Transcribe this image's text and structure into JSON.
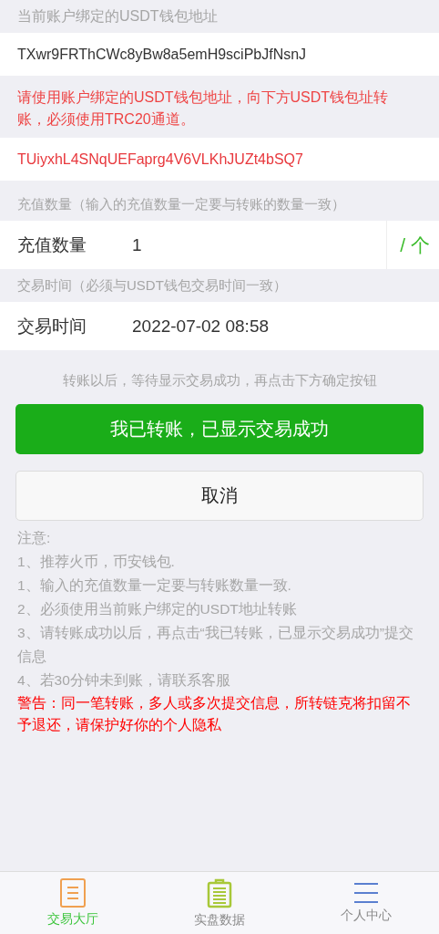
{
  "bound_wallet": {
    "label": "当前账户绑定的USDT钱包地址",
    "address": "TXwr9FRThCWc8yBw8a5emH9sciPbJfNsnJ"
  },
  "deposit_wallet": {
    "instruction": "请使用账户绑定的USDT钱包地址，向下方USDT钱包址转账，必须使用TRC20通道。",
    "address": "TUiyxhL4SNqUEFaprg4V6VLKhJUZt4bSQ7"
  },
  "amount": {
    "hint": "充值数量（输入的充值数量一定要与转账的数量一致）",
    "label": "充值数量",
    "value": "1",
    "unit": "/ 个"
  },
  "time": {
    "hint": "交易时间（必须与USDT钱包交易时间一致）",
    "label": "交易时间",
    "value": "2022-07-02 08:58"
  },
  "confirm_hint": "转账以后，等待显示交易成功，再点击下方确定按钮",
  "buttons": {
    "confirm": "我已转账，已显示交易成功",
    "cancel": "取消"
  },
  "notes": {
    "title": "注意:",
    "items": [
      "1、推荐火币，币安钱包.",
      "1、输入的充值数量一定要与转账数量一致.",
      "2、必须使用当前账户绑定的USDT地址转账",
      "3、请转账成功以后，再点击“我已转账，已显示交易成功”提交信息",
      "4、若30分钟未到账，请联系客服"
    ],
    "warning": "警告：同一笔转账，多人或多次提交信息，所转链克将扣留不予退还，请保护好你的个人隐私"
  },
  "tab_bar": [
    {
      "label": "交易大厅",
      "selected": true
    },
    {
      "label": "实盘数据",
      "selected": false
    },
    {
      "label": "个人中心",
      "selected": false
    }
  ]
}
